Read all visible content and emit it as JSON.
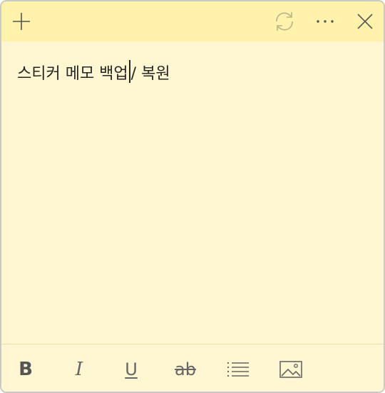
{
  "titlebar": {
    "icons": {
      "new": "plus-icon",
      "sync": "sync-icon",
      "menu": "more-icon",
      "close": "close-icon"
    }
  },
  "note": {
    "text_before_caret": "스티커 메모 백업",
    "text_after_caret": "/ 복원"
  },
  "toolbar": {
    "bold_label": "B",
    "italic_label": "I",
    "underline_label": "U",
    "strike_label": "ab",
    "icons": {
      "list": "bullet-list-icon",
      "image": "image-icon"
    }
  },
  "colors": {
    "titlebar": "#fff2ab",
    "body": "#fff7d1",
    "border": "#c9c9c9"
  }
}
